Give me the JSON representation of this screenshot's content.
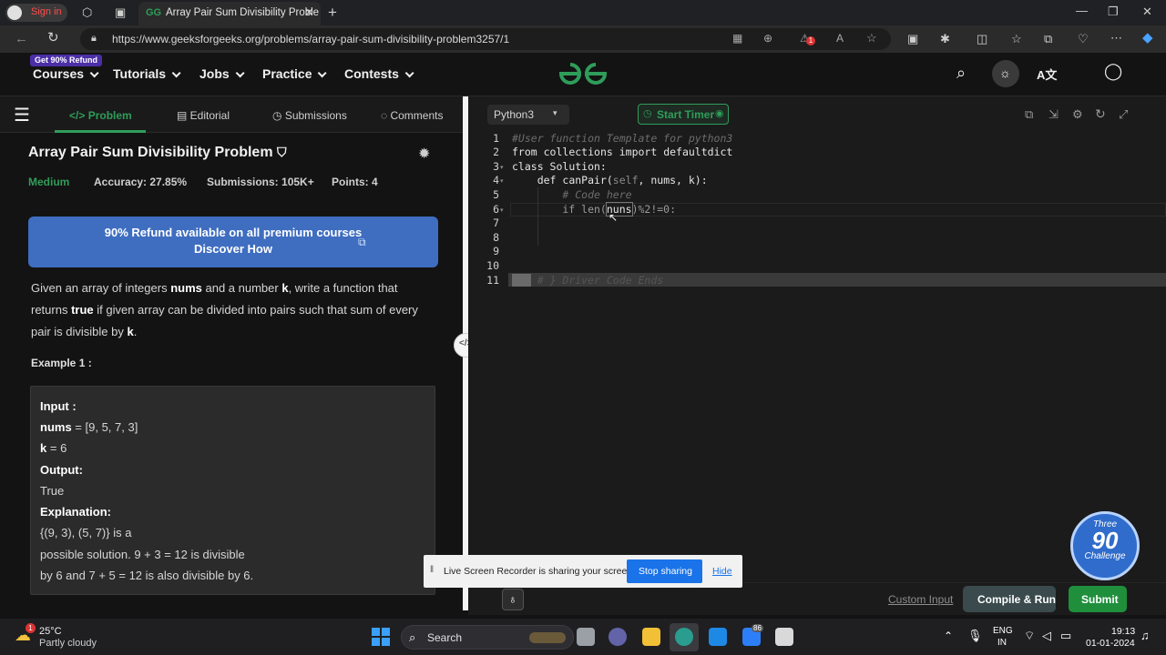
{
  "browser": {
    "tab_title": "Array Pair Sum Divisibility Proble",
    "signin_label": "Sign in",
    "url": "https://www.geeksforgeeks.org/problems/array-pair-sum-divisibility-problem3257/1",
    "ext_badge": "1"
  },
  "nav": {
    "badge": "Get 90% Refund",
    "courses": "Courses",
    "tutorials": "Tutorials",
    "jobs": "Jobs",
    "practice": "Practice",
    "contests": "Contests",
    "logo": "GG"
  },
  "left": {
    "tabs": [
      "Problem",
      "Editorial",
      "Submissions",
      "Comments"
    ],
    "title": "Array Pair Sum Divisibility Problem",
    "difficulty": "Medium",
    "accuracy": "Accuracy: 27.85%",
    "submissions": "Submissions: 105K+",
    "points": "Points: 4",
    "banner_line1": "90% Refund available on all premium courses",
    "banner_line2": "Discover How",
    "desc_p1": "Given an array of integers ",
    "desc_b1": "nums",
    "desc_p2": " and a number ",
    "desc_b2": "k",
    "desc_p3": ", write a function that returns ",
    "desc_b3": "true",
    "desc_p4": " if given array can be divided into pairs such that sum of every pair is divisible by ",
    "desc_b4": "k",
    "desc_p5": ".",
    "example_label": "Example 1 :",
    "ex_input": "Input",
    "ex_colon": ":",
    "ex_nums_label": "nums",
    "ex_nums_value": "= [9, 5, 7, 3]",
    "ex_k_label": "k",
    "ex_k_value": "= 6",
    "ex_output": "Output:",
    "ex_true": "True",
    "ex_explanation": "Explanation:",
    "ex_line1": "{(9, 3), (5, 7)} is a",
    "ex_line2": "possible solution. 9 + 3 = 12 is divisible",
    "ex_line3": "by 6 and 7 + 5 = 12 is also divisible by 6."
  },
  "editor": {
    "language": "Python3",
    "timer": "Start Timer",
    "lines": [
      "1",
      "2",
      "3",
      "4",
      "5",
      "6",
      "7",
      "8",
      "9",
      "10",
      "11"
    ],
    "code": {
      "l1": "#User function Template for python3",
      "l2a": "from",
      "l2b": " collections ",
      "l2c": "import",
      "l2d": " defaultdict",
      "l3a": "class",
      "l3b": " Solution:",
      "l4a": "    def ",
      "l4b": "canPair",
      "l4c": "(",
      "l4d": "self",
      "l4e": ", nums, k):",
      "l5": "        # Code here",
      "l6a": "        if len(",
      "l6b": "nuns",
      "l6c": ")%2!=0:",
      "l11": "# } Driver Code Ends"
    },
    "custom_input": "Custom Input",
    "compile": "Compile & Run",
    "submit": "Submit"
  },
  "badge": {
    "top": "Three",
    "num": "90",
    "bottom": "Challenge"
  },
  "share": {
    "message": "Live Screen Recorder is sharing your screen.",
    "stop": "Stop sharing",
    "hide": "Hide"
  },
  "taskbar": {
    "temp": "25°C",
    "weather": "Partly cloudy",
    "weather_badge": "1",
    "search": "Search",
    "notif_count": "86",
    "lang1": "ENG",
    "lang2": "IN",
    "time": "19:13",
    "date": "01-01-2024"
  },
  "colors": {
    "green": "#2f9d5a",
    "banner": "#3f6ec0",
    "submit": "#1f8f3c"
  }
}
